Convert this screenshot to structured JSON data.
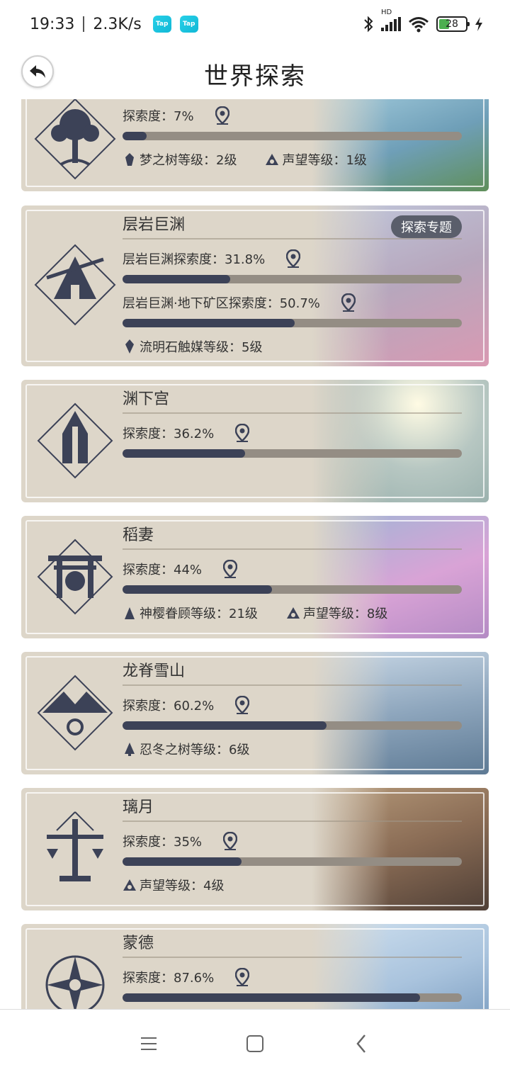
{
  "status": {
    "time": "19:33",
    "speed": "2.3K/s",
    "tap1": "Tap",
    "tap2": "Tap",
    "network": "HD",
    "battery": "28"
  },
  "header": {
    "title": "世界探索"
  },
  "regions": [
    {
      "name": "",
      "progress_label": "探索度：7%",
      "progress": 0.07,
      "stats": [
        "梦之树等级：2级",
        "声望等级：1级"
      ],
      "scene": "#7fb0c8"
    },
    {
      "name": "层岩巨渊",
      "badge": "探索专题",
      "progress_label": "层岩巨渊探索度：31.8%",
      "progress": 0.318,
      "progress2_label": "层岩巨渊·地下矿区探索度：50.7%",
      "progress2": 0.507,
      "stats": [
        "流明石触媒等级：5级"
      ],
      "scene": "#c9a3b8"
    },
    {
      "name": "渊下宫",
      "progress_label": "探索度：36.2%",
      "progress": 0.362,
      "stats": [],
      "scene": "#b9c4bf"
    },
    {
      "name": "稻妻",
      "progress_label": "探索度：44%",
      "progress": 0.44,
      "stats": [
        "神樱眷顾等级：21级",
        "声望等级：8级"
      ],
      "scene": "#d6a4cf"
    },
    {
      "name": "龙脊雪山",
      "progress_label": "探索度：60.2%",
      "progress": 0.602,
      "stats": [
        "忍冬之树等级：6级"
      ],
      "scene": "#8fa8c0"
    },
    {
      "name": "璃月",
      "progress_label": "探索度：35%",
      "progress": 0.35,
      "stats": [
        "声望等级：4级"
      ],
      "scene": "#9a7e66"
    },
    {
      "name": "蒙德",
      "progress_label": "探索度：87.6%",
      "progress": 0.876,
      "stats": [],
      "scene": "#a9c3dd"
    }
  ]
}
